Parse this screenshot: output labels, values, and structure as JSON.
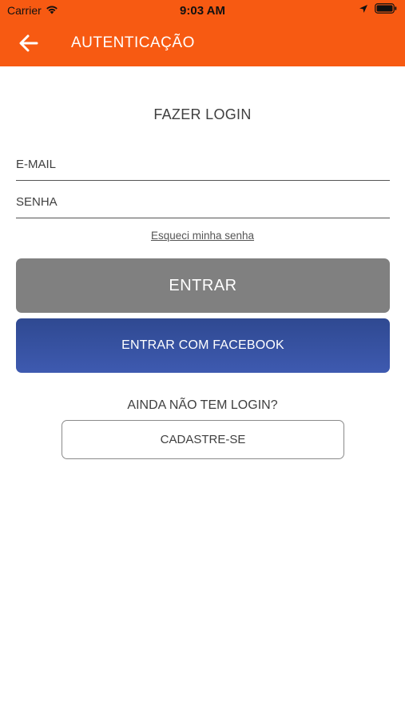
{
  "status_bar": {
    "carrier": "Carrier",
    "time": "9:03 AM",
    "icons": [
      "wifi-icon",
      "location-arrow-icon",
      "battery-icon"
    ]
  },
  "navbar": {
    "back_icon": "arrow-left-icon",
    "title": "AUTENTICAÇÃO",
    "background_color": "#f75a12"
  },
  "login_form": {
    "title": "FAZER LOGIN",
    "email_placeholder": "E-MAIL",
    "password_placeholder": "SENHA",
    "forgot_password": "Esqueci minha senha",
    "submit_label": "ENTRAR",
    "facebook_label": "ENTRAR COM FACEBOOK",
    "submit_color": "#808080",
    "facebook_color": "#3a53a4"
  },
  "signup": {
    "prompt": "AINDA NÃO TEM LOGIN?",
    "button_label": "CADASTRE-SE"
  }
}
